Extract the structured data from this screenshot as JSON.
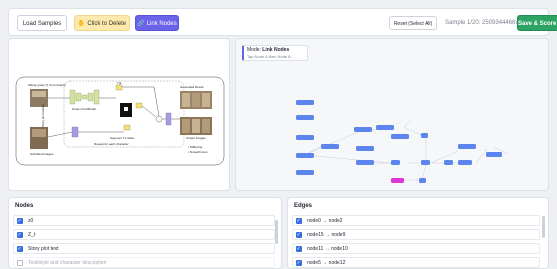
{
  "toolbar": {
    "load_label": "Load Samples",
    "delete_label": "Click to Delete",
    "link_label": "Link Nodes",
    "reset_label": "Reset (Select All)",
    "sample_text": "Sample 1/20: 2509344466v1",
    "save_label": "Save & Score »"
  },
  "mode": {
    "prefix": "Mode:",
    "value": "Link Nodes",
    "hint": "Tap Node A then Node B"
  },
  "figure": {
    "labels": {
      "conditioning": "Sitting group (7 Cont.Graph)",
      "unet": "Noise Unet/Model",
      "tgt": "Tgt",
      "result": "Generated Result",
      "storyline": "Story plot textline",
      "mask": "Segment T-masks",
      "output": "Output Images",
      "repeat": "Repeat for each character",
      "scribble": "Scribbled Images",
      "legend_a": "• Stiffening",
      "legend_b": "• Noise/Frozen"
    }
  },
  "nodes_panel": {
    "title": "Nodes",
    "items": [
      {
        "label": "z0",
        "checked": true
      },
      {
        "label": "Z_t",
        "checked": true
      },
      {
        "label": "Story plot text",
        "checked": true
      },
      {
        "label": "Text/style and character description",
        "checked": false
      }
    ]
  },
  "edges_panel": {
    "title": "Edges",
    "items": [
      {
        "label": "node0 → node2",
        "checked": true
      },
      {
        "label": "node15 → node9",
        "checked": true
      },
      {
        "label": "node11 → node10",
        "checked": true
      },
      {
        "label": "node5 → node12",
        "checked": true
      }
    ]
  },
  "colors": {
    "accent": "#6a62e8",
    "save": "#2ea464",
    "delete": "#fbe9ad",
    "node": "#5c86ee",
    "node_selected": "#dd37d5"
  }
}
